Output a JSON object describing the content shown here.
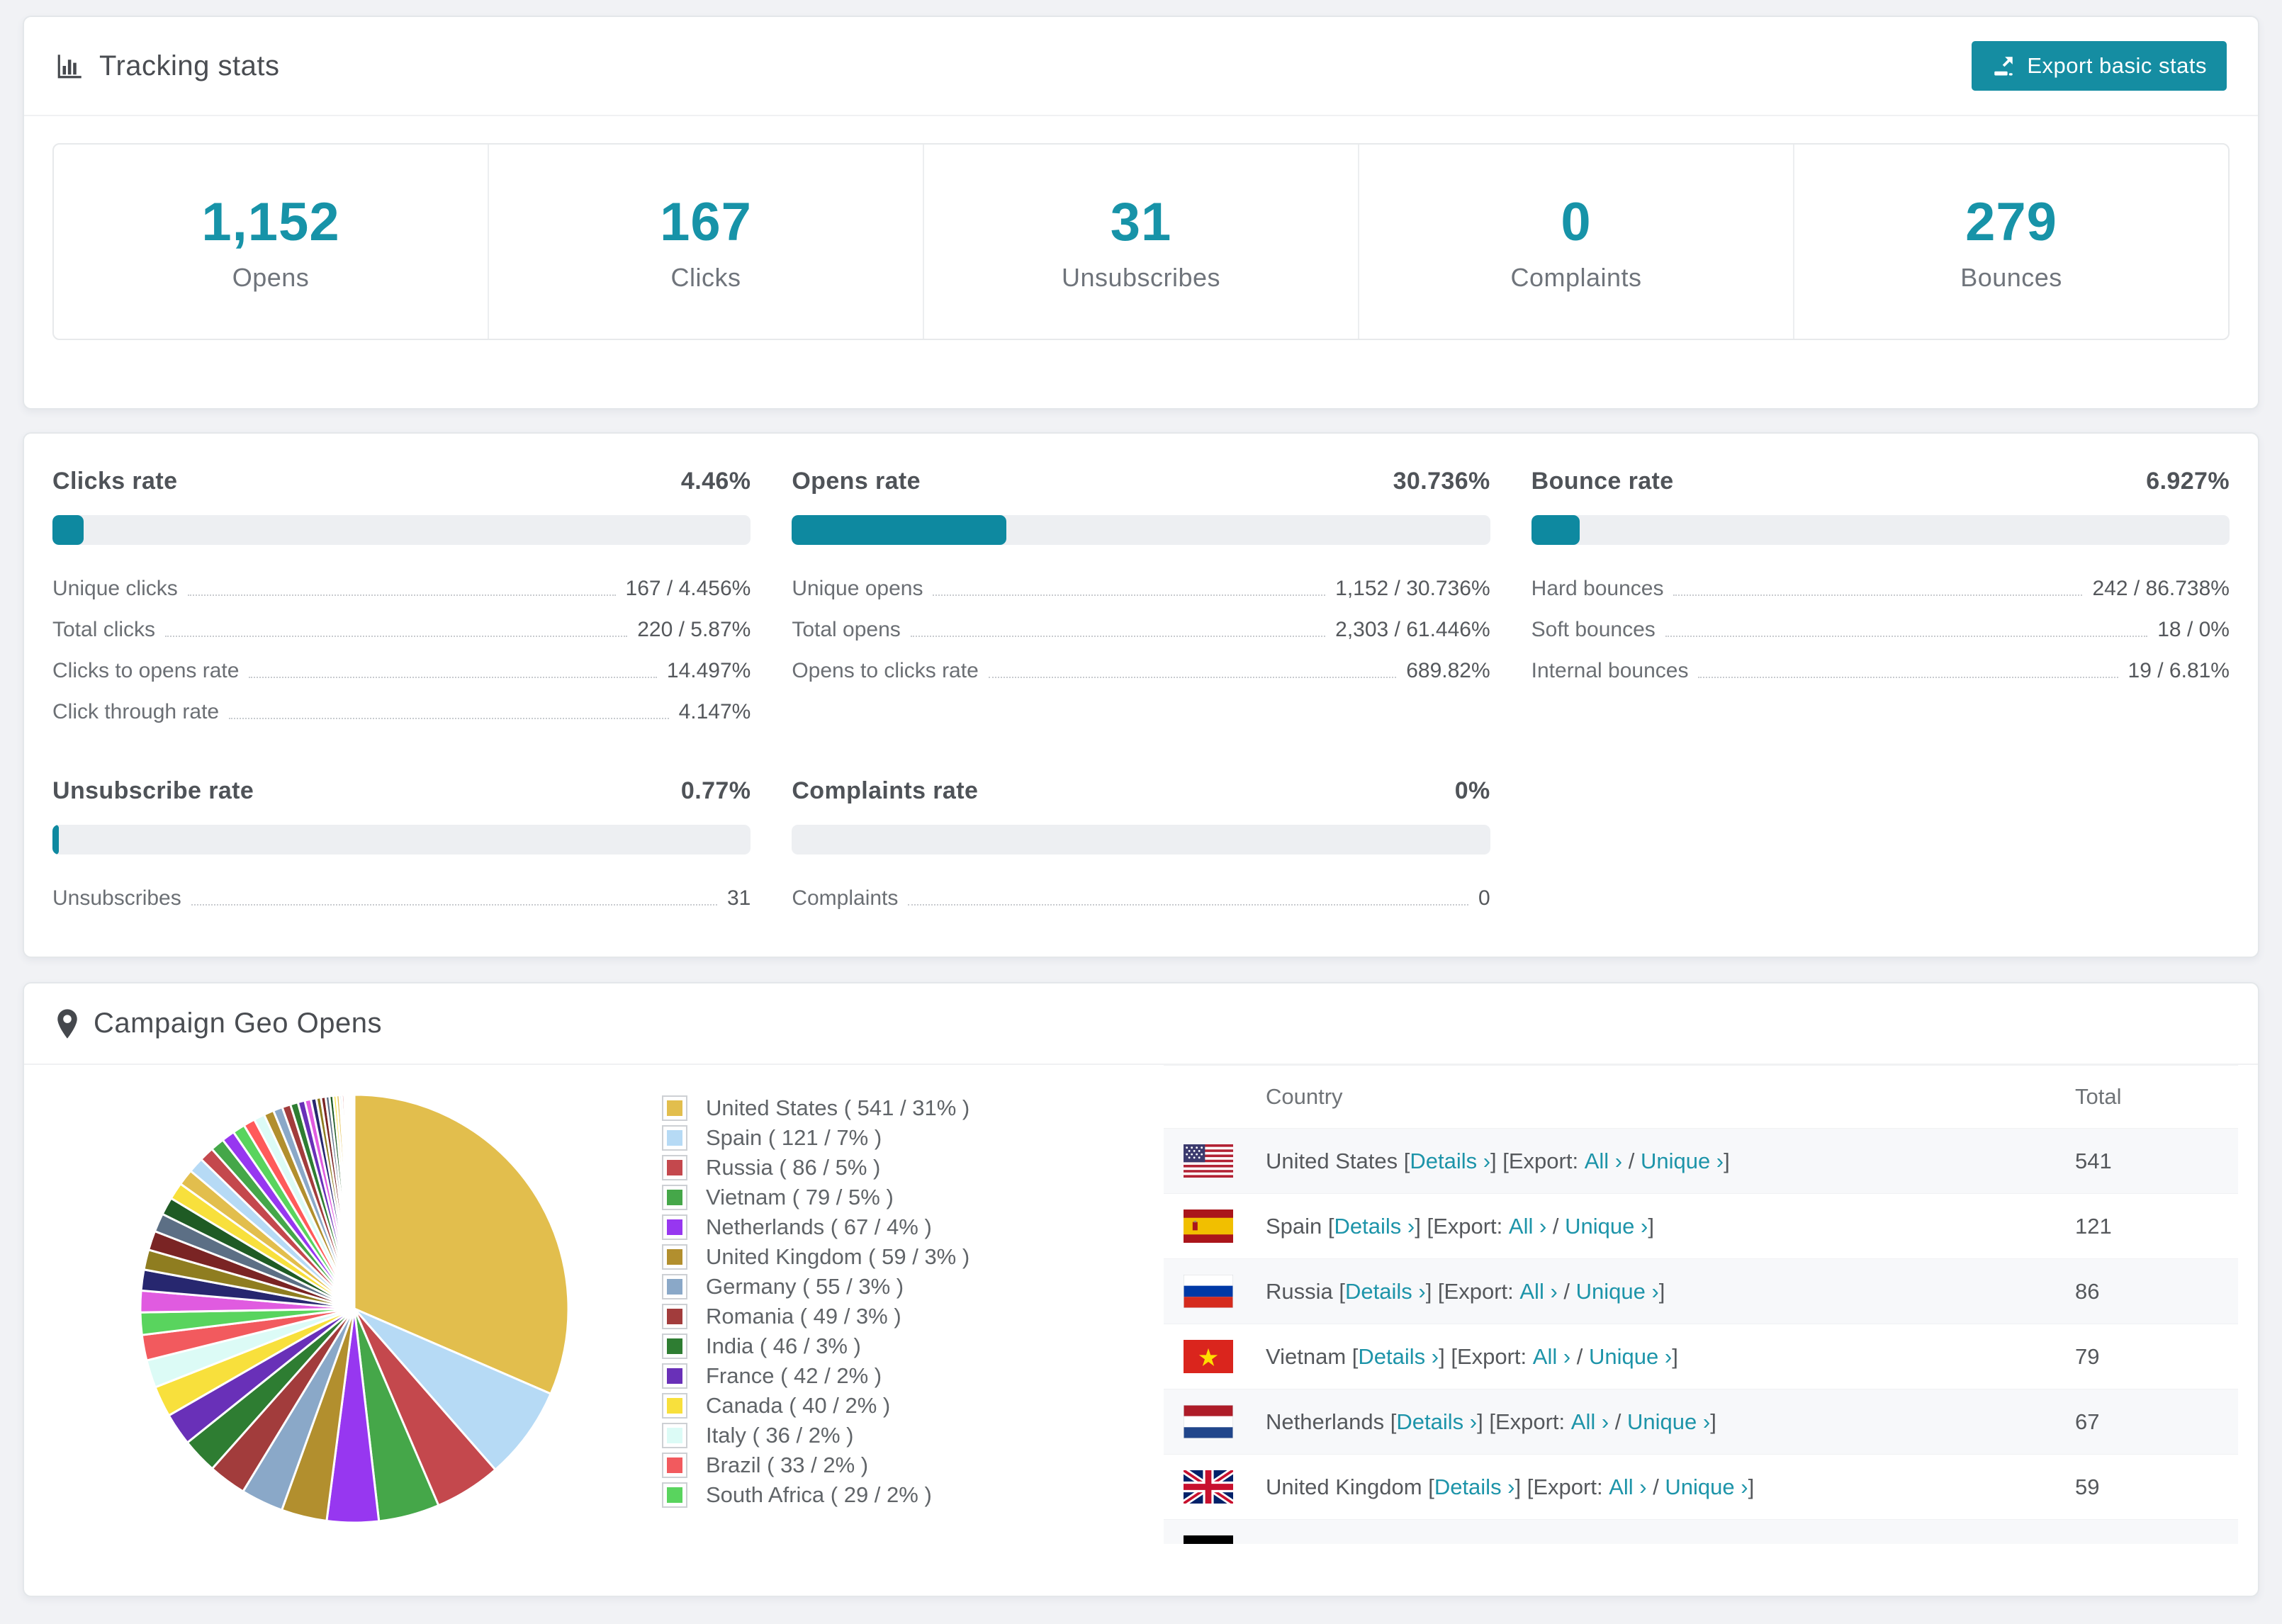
{
  "accent_color": "#158DA2",
  "tracking": {
    "title": "Tracking stats",
    "export_label": "Export basic stats",
    "summary": [
      {
        "value": "1,152",
        "label": "Opens"
      },
      {
        "value": "167",
        "label": "Clicks"
      },
      {
        "value": "31",
        "label": "Unsubscribes"
      },
      {
        "value": "0",
        "label": "Complaints"
      },
      {
        "value": "279",
        "label": "Bounces"
      }
    ]
  },
  "rates": [
    {
      "key": "clicks",
      "title": "Clicks rate",
      "value": "4.46%",
      "percent": 4.46,
      "rows": [
        {
          "label": "Unique clicks",
          "value": "167 / 4.456%"
        },
        {
          "label": "Total clicks",
          "value": "220 / 5.87%"
        },
        {
          "label": "Clicks to opens rate",
          "value": "14.497%"
        },
        {
          "label": "Click through rate",
          "value": "4.147%"
        }
      ]
    },
    {
      "key": "opens",
      "title": "Opens rate",
      "value": "30.736%",
      "percent": 30.736,
      "rows": [
        {
          "label": "Unique opens",
          "value": "1,152 / 30.736%"
        },
        {
          "label": "Total opens",
          "value": "2,303 / 61.446%"
        },
        {
          "label": "Opens to clicks rate",
          "value": "689.82%"
        }
      ]
    },
    {
      "key": "bounce",
      "title": "Bounce rate",
      "value": "6.927%",
      "percent": 6.927,
      "rows": [
        {
          "label": "Hard bounces",
          "value": "242 / 86.738%"
        },
        {
          "label": "Soft bounces",
          "value": "18 / 0%"
        },
        {
          "label": "Internal bounces",
          "value": "19 / 6.81%"
        }
      ]
    },
    {
      "key": "unsubscribe",
      "title": "Unsubscribe rate",
      "value": "0.77%",
      "percent": 0.77,
      "rows": [
        {
          "label": "Unsubscribes",
          "value": "31"
        }
      ]
    },
    {
      "key": "complaints",
      "title": "Complaints rate",
      "value": "0%",
      "percent": 0,
      "rows": [
        {
          "label": "Complaints",
          "value": "0"
        }
      ]
    }
  ],
  "geo": {
    "title": "Campaign Geo Opens",
    "legend": [
      "United States ( 541 / 31% )",
      "Spain ( 121 / 7% )",
      "Russia ( 86 / 5% )",
      "Vietnam ( 79 / 5% )",
      "Netherlands ( 67 / 4% )",
      "United Kingdom ( 59 / 3% )",
      "Germany ( 55 / 3% )",
      "Romania ( 49 / 3% )",
      "India ( 46 / 3% )",
      "France ( 42 / 2% )",
      "Canada ( 40 / 2% )",
      "Italy ( 36 / 2% )",
      "Brazil ( 33 / 2% )",
      "South Africa ( 29 / 2% )"
    ],
    "table": {
      "columns": [
        "Country",
        "Total"
      ],
      "labels": {
        "open_bracket": "[",
        "details": "Details ›",
        "close_open": "] [Export: ",
        "all": "All ›",
        "slash": " / ",
        "unique": "Unique ›",
        "close_bracket": "]"
      },
      "rows": [
        {
          "country": "United States",
          "flag": "us",
          "total": "541"
        },
        {
          "country": "Spain",
          "flag": "es",
          "total": "121"
        },
        {
          "country": "Russia",
          "flag": "ru",
          "total": "86"
        },
        {
          "country": "Vietnam",
          "flag": "vn",
          "total": "79"
        },
        {
          "country": "Netherlands",
          "flag": "nl",
          "total": "67"
        },
        {
          "country": "United Kingdom",
          "flag": "gb",
          "total": "59"
        },
        {
          "country": "",
          "flag": "de",
          "total": "",
          "partial": true
        }
      ]
    }
  },
  "chart_data": {
    "type": "pie",
    "title": "Campaign Geo Opens",
    "legend_position": "right",
    "start_angle_deg": 0,
    "direction": "clockwise",
    "slices": [
      {
        "label": "United States",
        "value": 541,
        "pct": 31,
        "color": "#E2BE4D"
      },
      {
        "label": "Spain",
        "value": 121,
        "pct": 7,
        "color": "#B6DAF5"
      },
      {
        "label": "Russia",
        "value": 86,
        "pct": 5,
        "color": "#C4484D"
      },
      {
        "label": "Vietnam",
        "value": 79,
        "pct": 5,
        "color": "#45A749"
      },
      {
        "label": "Netherlands",
        "value": 67,
        "pct": 4,
        "color": "#9737F0"
      },
      {
        "label": "United Kingdom",
        "value": 59,
        "pct": 3,
        "color": "#B28F2E"
      },
      {
        "label": "Germany",
        "value": 55,
        "pct": 3,
        "color": "#8AA8C8"
      },
      {
        "label": "Romania",
        "value": 49,
        "pct": 3,
        "color": "#A23C3C"
      },
      {
        "label": "India",
        "value": 46,
        "pct": 3,
        "color": "#2E7D32"
      },
      {
        "label": "France",
        "value": 42,
        "pct": 2,
        "color": "#6930B8"
      },
      {
        "label": "Canada",
        "value": 40,
        "pct": 2,
        "color": "#F8E03C"
      },
      {
        "label": "Italy",
        "value": 36,
        "pct": 2,
        "color": "#DCFBF6"
      },
      {
        "label": "Brazil",
        "value": 33,
        "pct": 2,
        "color": "#F25A5E"
      },
      {
        "label": "South Africa",
        "value": 29,
        "pct": 2,
        "color": "#59D45E"
      }
    ],
    "other_slice_values": [
      28,
      27,
      26,
      25,
      24,
      23,
      22,
      21,
      20,
      19,
      18,
      17,
      16,
      15,
      14,
      13,
      12,
      11,
      10,
      9,
      8,
      7,
      6,
      6,
      5,
      5,
      4,
      4,
      3,
      3,
      2,
      2,
      2,
      1,
      1,
      1,
      1,
      1,
      1,
      1
    ],
    "other_slice_palette": [
      "#E05BE0",
      "#27276F",
      "#8F7D20",
      "#7A2424",
      "#5C6F85",
      "#1F5B24",
      "#F8E03C",
      "#E2BE4D",
      "#B6DAF5",
      "#C4484D",
      "#45A749",
      "#9737F0",
      "#59D45E",
      "#FF5A5A",
      "#DCFBF6",
      "#B28F2E",
      "#8AA8C8",
      "#A23C3C",
      "#2E7D32",
      "#6930B8"
    ]
  }
}
